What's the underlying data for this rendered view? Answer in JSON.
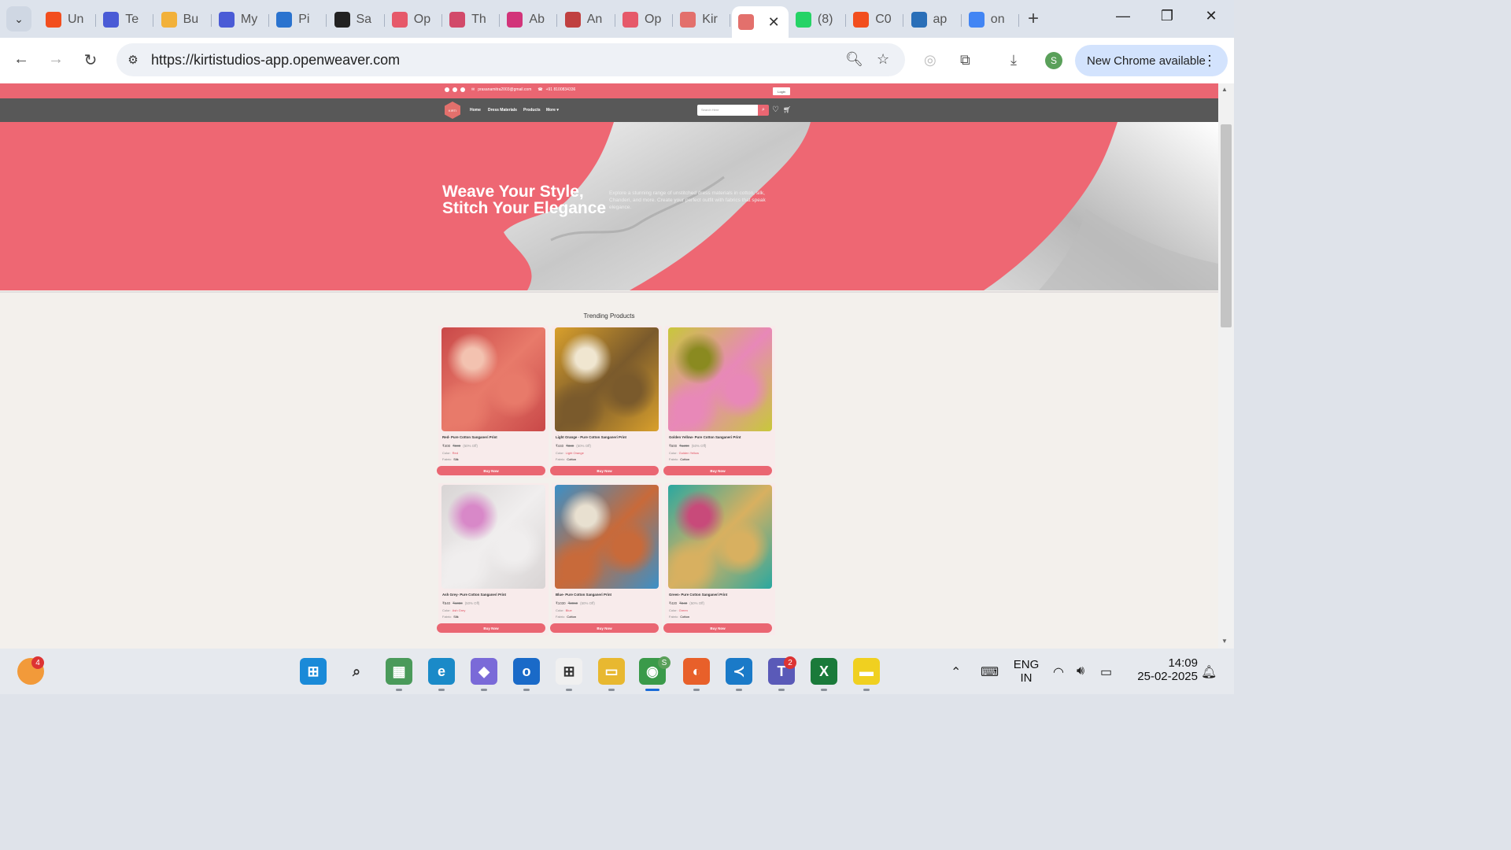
{
  "browser": {
    "tabs": [
      {
        "label": "Un",
        "icon": "figma-icon",
        "color": "#f24e1e"
      },
      {
        "label": "Te",
        "icon": "form-icon",
        "color": "#4a5bd6"
      },
      {
        "label": "Bu",
        "icon": "chart-icon",
        "color": "#f2b13a"
      },
      {
        "label": "My",
        "icon": "form-icon",
        "color": "#4a5bd6"
      },
      {
        "label": "Pi",
        "icon": "devops-icon",
        "color": "#2a73cf"
      },
      {
        "label": "Sa",
        "icon": "openai-icon",
        "color": "#222222"
      },
      {
        "label": "Op",
        "icon": "circle-logo-icon",
        "color": "#e6596a"
      },
      {
        "label": "Th",
        "icon": "site-icon",
        "color": "#d24a6a"
      },
      {
        "label": "Ab",
        "icon": "triangle-logo-icon",
        "color": "#d2347a"
      },
      {
        "label": "An",
        "icon": "devanagari-icon",
        "color": "#c04040"
      },
      {
        "label": "Op",
        "icon": "circle-logo-icon",
        "color": "#e6596a"
      },
      {
        "label": "Kir",
        "icon": "kirti-logo-icon",
        "color": "#e3706c"
      },
      {
        "label": "",
        "icon": "kirti-logo-icon",
        "color": "#e3706c"
      },
      {
        "label": "(8)",
        "icon": "whatsapp-icon",
        "color": "#25d366"
      },
      {
        "label": "C0",
        "icon": "figma-icon",
        "color": "#f24e1e"
      },
      {
        "label": "ap",
        "icon": "s-logo-icon",
        "color": "#2a6fb8"
      },
      {
        "label": "on",
        "icon": "google-icon",
        "color": "#4285f4"
      }
    ],
    "url": "https://kirtistudios-app.openweaver.com",
    "update_label": "New Chrome available",
    "profile_initial": "S"
  },
  "site": {
    "topbar": {
      "email": "prasanamitra2003@gmail.com",
      "phone": "+91 8100834336",
      "login_label": "Login"
    },
    "nav": {
      "logo_text": "KIRTI",
      "links": [
        "Home",
        "Dress Materials",
        "Products",
        "More ▾"
      ],
      "search_placeholder": "Search Here"
    },
    "hero": {
      "title": "Weave Your Style, Stitch Your Elegance",
      "description": "Explore a stunning range of unstitched dress materials in cotton, silk, Chanderi, and more. Create your perfect outfit with fabrics that speak elegance."
    },
    "trending_title": "Trending  Products",
    "products": [
      {
        "name": "Red- Pure Cotton Sanganeri Print",
        "price": "₹400",
        "old_price": "₹800",
        "discount": "(50% Off)",
        "color_label": "Color:",
        "color": "Red",
        "fabric_label": "Fabric:",
        "fabric": "Silk",
        "buy_label": "Buy Now",
        "img": [
          "#c94848",
          "#e87a6a",
          "#f3c2b0"
        ]
      },
      {
        "name": "Light Orange - Pure Cotton Sanganeri Print",
        "price": "₹440",
        "old_price": "₹880",
        "discount": "(50% Off)",
        "color_label": "Color:",
        "color": "Light Orange",
        "fabric_label": "Fabric:",
        "fabric": "Cotton",
        "buy_label": "Buy Now",
        "img": [
          "#d9a02c",
          "#7a5a2c",
          "#f0e6d0"
        ]
      },
      {
        "name": "Golden Yellow- Pure Cotton Sanganeri Print",
        "price": "₹600",
        "old_price": "₹1200",
        "discount": "(50% Off)",
        "color_label": "Color:",
        "color": "Golden Yellow",
        "fabric_label": "Fabric:",
        "fabric": "Cotton",
        "buy_label": "Buy Now",
        "img": [
          "#c8c83a",
          "#e888b8",
          "#8a8a20"
        ]
      },
      {
        "name": "Ash Grey- Pure Cotton Sanganeri Print",
        "price": "₹540",
        "old_price": "₹1080",
        "discount": "(50% Off)",
        "color_label": "Color:",
        "color": "Ash  Grey",
        "fabric_label": "Fabric:",
        "fabric": "Silk",
        "buy_label": "Buy Now",
        "img": [
          "#d8d4d4",
          "#f0eeee",
          "#d888c8"
        ]
      },
      {
        "name": "Blue- Pure Cotton Sanganeri Print",
        "price": "₹1030",
        "old_price": "₹2060",
        "discount": "(50% Off)",
        "color_label": "Color:",
        "color": "Blue",
        "fabric_label": "Fabric:",
        "fabric": "Cotton",
        "buy_label": "Buy Now",
        "img": [
          "#3a90c8",
          "#c86a3a",
          "#e8e0d0"
        ]
      },
      {
        "name": "Green- Pure Cotton Sanganeri Print",
        "price": "₹420",
        "old_price": "₹840",
        "discount": "(50% Off)",
        "color_label": "Color:",
        "color": "Green",
        "fabric_label": "Fabric:",
        "fabric": "Cotton",
        "buy_label": "Buy Now",
        "img": [
          "#2aa8a0",
          "#d8b060",
          "#c84a7a"
        ]
      }
    ]
  },
  "taskbar": {
    "apps": [
      {
        "name": "start-icon",
        "color": "#1a8ad8",
        "glyph": "⊞"
      },
      {
        "name": "search-icon",
        "color": "transparent",
        "glyph": "⌕"
      },
      {
        "name": "photos-icon",
        "color": "#4a9a5a",
        "glyph": "▦"
      },
      {
        "name": "edge-icon",
        "color": "#1a8ac8",
        "glyph": "e"
      },
      {
        "name": "copilot-icon",
        "color": "#7a6ad8",
        "glyph": "◆"
      },
      {
        "name": "outlook-icon",
        "color": "#1a6ac8",
        "glyph": "o"
      },
      {
        "name": "store-icon",
        "color": "#f0f0f0",
        "glyph": "⊞"
      },
      {
        "name": "file-explorer-icon",
        "color": "#e8b830",
        "glyph": "▭"
      },
      {
        "name": "chrome-icon",
        "color": "#3a9a4a",
        "glyph": "◉"
      },
      {
        "name": "firefox-icon",
        "color": "#e8602a",
        "glyph": "◐"
      },
      {
        "name": "vscode-icon",
        "color": "#1a7ac8",
        "glyph": "≺"
      },
      {
        "name": "teams-icon",
        "color": "#5a5ab8",
        "glyph": "T"
      },
      {
        "name": "excel-icon",
        "color": "#1a7a3a",
        "glyph": "X"
      },
      {
        "name": "sticky-notes-icon",
        "color": "#f0d020",
        "glyph": "▬"
      }
    ],
    "badge_left": "4",
    "teams_badge": "2",
    "chrome_badge": "S",
    "lang_line1": "ENG",
    "lang_line2": "IN",
    "time": "14:09",
    "date": "25-02-2025"
  }
}
